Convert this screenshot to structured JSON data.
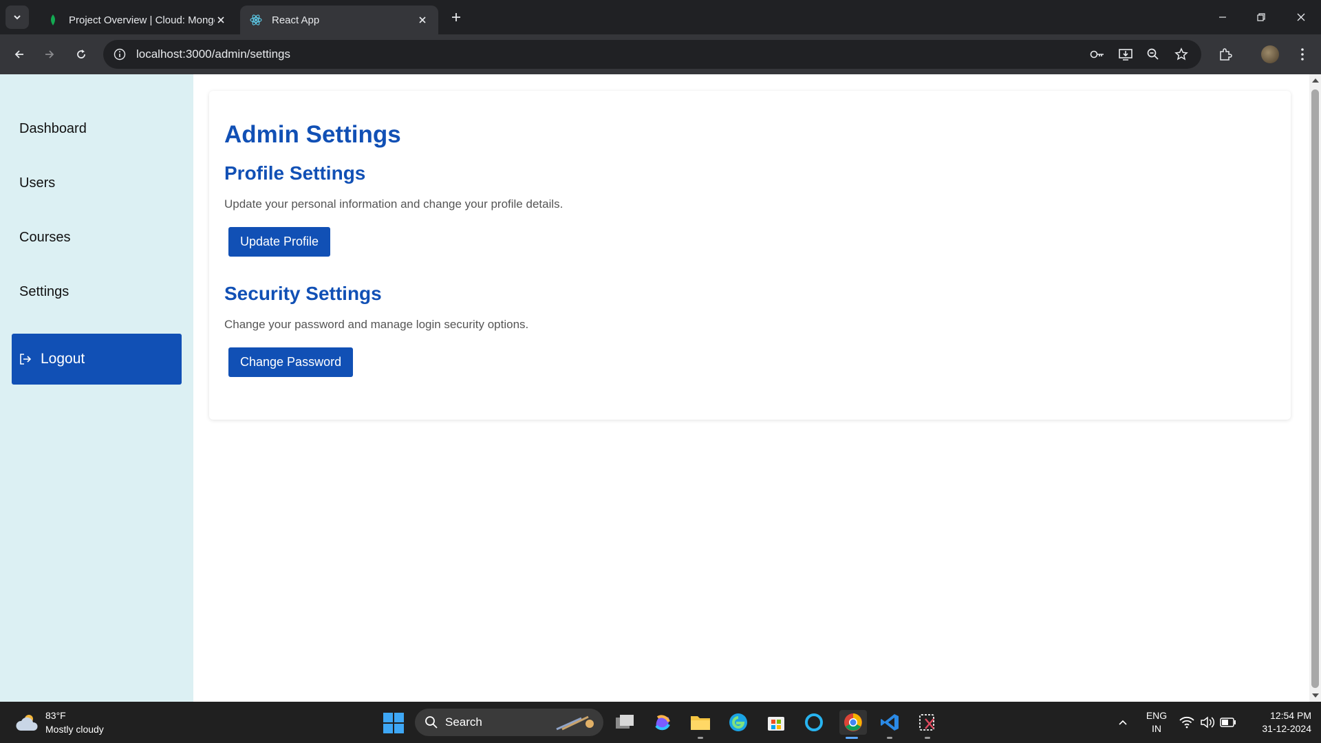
{
  "browser": {
    "tabs": [
      {
        "title": "Project Overview | Cloud: MongoDB Cloud",
        "active": false,
        "favicon": "mongodb-leaf-icon"
      },
      {
        "title": "React App",
        "active": true,
        "favicon": "react-icon"
      }
    ],
    "url": "localhost:3000/admin/settings"
  },
  "sidebar": {
    "items": [
      {
        "label": "Dashboard"
      },
      {
        "label": "Users"
      },
      {
        "label": "Courses"
      },
      {
        "label": "Settings"
      }
    ],
    "logout_label": "Logout"
  },
  "main": {
    "title": "Admin Settings",
    "sections": [
      {
        "heading": "Profile Settings",
        "description": "Update your personal information and change your profile details.",
        "button_label": "Update Profile"
      },
      {
        "heading": "Security Settings",
        "description": "Change your password and manage login security options.",
        "button_label": "Change Password"
      }
    ]
  },
  "taskbar": {
    "weather_temp": "83°F",
    "weather_desc": "Mostly cloudy",
    "search_label": "Search",
    "lang_line1": "ENG",
    "lang_line2": "IN",
    "time": "12:54 PM",
    "date": "31-12-2024"
  },
  "colors": {
    "accent": "#1150b5",
    "sidebar_bg": "#dcf0f3",
    "browser_dark": "#202124",
    "taskbar_bg": "#202020"
  }
}
